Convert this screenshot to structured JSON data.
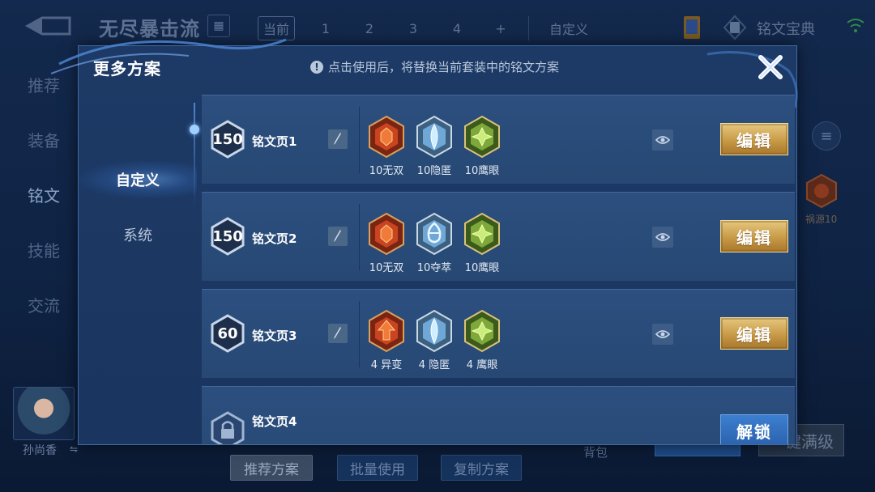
{
  "background": {
    "title": "无尽暴击流",
    "tabs": [
      "当前",
      "1",
      "2",
      "3",
      "4",
      "+",
      "自定义"
    ],
    "codex_label": "铭文宝典",
    "side_menu": [
      "推荐",
      "装备",
      "铭文",
      "技能",
      "交流"
    ],
    "hero_name": "孙尚香",
    "hero_switch": "⇋",
    "bottom_buttons": [
      "推荐方案",
      "批量使用",
      "复制方案"
    ],
    "backpack_label": "背包",
    "max_level_label": "一键满级",
    "side_rune_label": "祸源10"
  },
  "modal": {
    "title": "更多方案",
    "notice": "点击使用后，将替换当前套装中的铭文方案",
    "nav": [
      "自定义",
      "系统"
    ],
    "edit_label": "编辑",
    "unlock_label": "解锁",
    "pages": [
      {
        "name": "铭文页1",
        "level": "150",
        "runes": [
          {
            "label": "10无双",
            "color": "red",
            "icon": "red-rune-icon"
          },
          {
            "label": "10隐匿",
            "color": "blue",
            "icon": "blue-rune-icon"
          },
          {
            "label": "10鹰眼",
            "color": "green",
            "icon": "green-rune-icon"
          }
        ]
      },
      {
        "name": "铭文页2",
        "level": "150",
        "runes": [
          {
            "label": "10无双",
            "color": "red",
            "icon": "red-rune-icon"
          },
          {
            "label": "10夺萃",
            "color": "blue",
            "icon": "blue-rune-icon"
          },
          {
            "label": "10鹰眼",
            "color": "green",
            "icon": "green-rune-icon"
          }
        ]
      },
      {
        "name": "铭文页3",
        "level": "60",
        "runes": [
          {
            "label": "4 异变",
            "color": "red",
            "icon": "red-rune-icon"
          },
          {
            "label": "4 隐匿",
            "color": "blue",
            "icon": "blue-rune-icon"
          },
          {
            "label": "4 鹰眼",
            "color": "green",
            "icon": "green-rune-icon"
          }
        ]
      },
      {
        "name": "铭文页4",
        "locked": true
      }
    ]
  },
  "colors": {
    "modal_bg": "#1d3a66",
    "row_bg": "#2c4f80",
    "edit_gold": "#c79a47",
    "unlock_blue": "#3c7fd0"
  }
}
